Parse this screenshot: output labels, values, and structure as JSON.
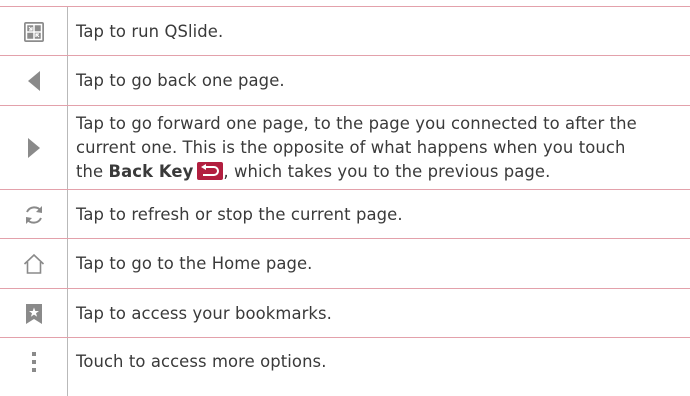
{
  "rows": [
    {
      "icon": "qslide-icon",
      "text": "Tap to run QSlide."
    },
    {
      "icon": "back-arrow-icon",
      "text": "Tap to go back one page."
    },
    {
      "icon": "forward-arrow-icon",
      "line1": "Tap to go forward one page, to the page you connected to after the",
      "line2": "current one. This is the opposite of what happens when you touch",
      "line3_pre": "the ",
      "line3_bold": "Back Key",
      "line3_post": ", which takes you to the previous page."
    },
    {
      "icon": "refresh-icon",
      "text": "Tap to refresh or stop the current page."
    },
    {
      "icon": "home-icon",
      "text": "Tap to go to the Home page."
    },
    {
      "icon": "bookmark-icon",
      "text": "Tap to access your bookmarks."
    },
    {
      "icon": "more-options-icon",
      "text": "Touch to access more options."
    }
  ],
  "colors": {
    "row_border": "#e3a1ab",
    "icon_gray": "#8a8a8a",
    "back_key": "#b21e3f"
  }
}
